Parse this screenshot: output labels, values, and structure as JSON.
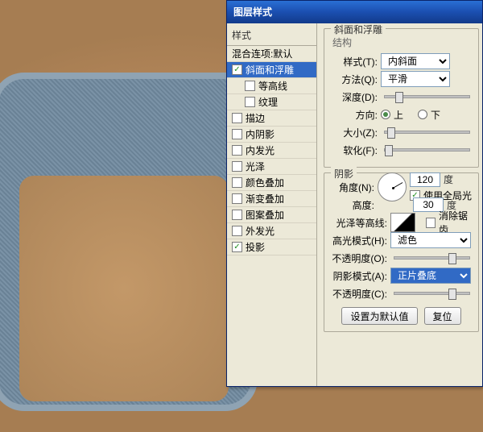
{
  "dialog_title": "图层样式",
  "styles_header": "样式",
  "blend_options": "混合连项:默认",
  "effects": [
    {
      "key": "bevel",
      "label": "斜面和浮雕",
      "checked": true,
      "selected": true,
      "indent": false
    },
    {
      "key": "contour_sub",
      "label": "等高线",
      "checked": false,
      "selected": false,
      "indent": true
    },
    {
      "key": "texture_sub",
      "label": "纹理",
      "checked": false,
      "selected": false,
      "indent": true
    },
    {
      "key": "stroke",
      "label": "描边",
      "checked": false,
      "selected": false,
      "indent": false
    },
    {
      "key": "inner_shadow",
      "label": "内阴影",
      "checked": false,
      "selected": false,
      "indent": false
    },
    {
      "key": "inner_glow",
      "label": "内发光",
      "checked": false,
      "selected": false,
      "indent": false
    },
    {
      "key": "satin",
      "label": "光泽",
      "checked": false,
      "selected": false,
      "indent": false
    },
    {
      "key": "color_overlay",
      "label": "颜色叠加",
      "checked": false,
      "selected": false,
      "indent": false
    },
    {
      "key": "grad_overlay",
      "label": "渐变叠加",
      "checked": false,
      "selected": false,
      "indent": false
    },
    {
      "key": "pat_overlay",
      "label": "图案叠加",
      "checked": false,
      "selected": false,
      "indent": false
    },
    {
      "key": "outer_glow",
      "label": "外发光",
      "checked": false,
      "selected": false,
      "indent": false
    },
    {
      "key": "drop_shadow",
      "label": "投影",
      "checked": true,
      "selected": false,
      "indent": false
    }
  ],
  "bevel": {
    "group_title": "斜面和浮雕",
    "structure_title": "结构",
    "style_label": "样式(T):",
    "style_value": "内斜面",
    "tech_label": "方法(Q):",
    "tech_value": "平滑",
    "depth_label": "深度(D):",
    "dir_label": "方向:",
    "dir_up": "上",
    "dir_down": "下",
    "dir_value": "up",
    "size_label": "大小(Z):",
    "soften_label": "软化(F):",
    "shadow_title": "阴影",
    "angle_label": "角度(N):",
    "angle_value": "120",
    "angle_unit": "度",
    "global_label": "使用全局光",
    "global_checked": true,
    "alt_label": "高度:",
    "alt_value": "30",
    "alt_unit": "度",
    "gloss_label": "光泽等高线:",
    "antialias_label": "消除锯齿",
    "hi_mode_label": "高光模式(H):",
    "hi_mode_value": "滤色",
    "hi_opac_label": "不透明度(O):",
    "sh_mode_label": "阴影模式(A):",
    "sh_mode_value": "正片叠底",
    "sh_opac_label": "不透明度(C):"
  },
  "buttons": {
    "default": "设置为默认值",
    "reset": "复位"
  }
}
